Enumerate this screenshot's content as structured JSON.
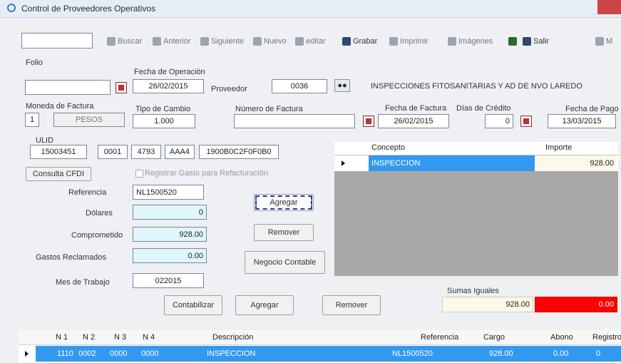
{
  "window": {
    "title": "Control de Proveedores Operativos"
  },
  "toolbar": {
    "buscar": "Buscar",
    "anterior": "Anterior",
    "siguiente": "Siguiente",
    "nuevo": "Nuevo",
    "editar": "editar",
    "grabar": "Grabar",
    "imprimir": "Imprimir",
    "imagenes": "Imágenes",
    "salir": "Salir",
    "m": "M"
  },
  "form": {
    "folio_label": "Folio",
    "folio_value": "",
    "fecha_op_label": "Fecha de Operación",
    "fecha_op_value": "26/02/2015",
    "proveedor_label": "Proveedor",
    "proveedor_value": "0036",
    "proveedor_name": "INSPECCIONES FITOSANITARIAS Y AD DE NVO LAREDO",
    "moneda_label": "Moneda de Factura",
    "moneda_code": "1",
    "moneda_value": "PESOS",
    "tipo_cambio_label": "Tipo de Cambio",
    "tipo_cambio_value": "1.000",
    "num_factura_label": "Número de Factura",
    "num_factura_value": "",
    "fecha_factura_label": "Fecha de Factura",
    "fecha_factura_value": "26/02/2015",
    "dias_credito_label": "Días de Crédito",
    "dias_credito_value": "0",
    "fecha_pago_label": "Fecha de Pago",
    "fecha_pago_value": "13/03/2015",
    "ulid_label": "ULID",
    "ulid_parts": [
      "15003451",
      "0001",
      "4793",
      "AAA4",
      "1900B0C2F0F0B0"
    ],
    "cfdi_button": "Consulta CFDI",
    "registrar_label": "Registrar Gasto para Refacturación",
    "referencia_label": "Referencia",
    "referencia_value": "NL1500520",
    "dolares_label": "Dólares",
    "dolares_value": "0",
    "comprometido_label": "Comprometido",
    "comprometido_value": "928.00",
    "gastos_label": "Gastos Reclamados",
    "gastos_value": "0.00",
    "mes_label": "Mes de Trabajo",
    "mes_value": "022015",
    "agregar_small": "Agregar",
    "remover_small": "Remover",
    "negocio_btn": "Negocio Contable",
    "contabilizar_btn": "Contabilizar",
    "agregar_btn": "Agregar",
    "remover_btn": "Remover",
    "sumas_label": "Sumas Iguales",
    "sumas_value": "928.00",
    "diff_value": "0.00"
  },
  "concept_grid": {
    "headers": [
      "Concepto",
      "Importe"
    ],
    "rows": [
      {
        "concepto": "INSPECCION",
        "importe": "928.00"
      }
    ]
  },
  "bottom_grid": {
    "headers": [
      "N 1",
      "N 2",
      "N 3",
      "N 4",
      "Descripción",
      "Referencia",
      "Cargo",
      "Abono",
      "Registro"
    ],
    "rows": [
      [
        "1110",
        "0002",
        "0000",
        "0000",
        "INSPECCION",
        "NL1500520",
        "928.00",
        "0.00",
        "0"
      ]
    ]
  },
  "colors": {
    "selection": "#3399ee",
    "diff_red": "#ff0000",
    "sumas_bg": "#fdf8e8"
  }
}
